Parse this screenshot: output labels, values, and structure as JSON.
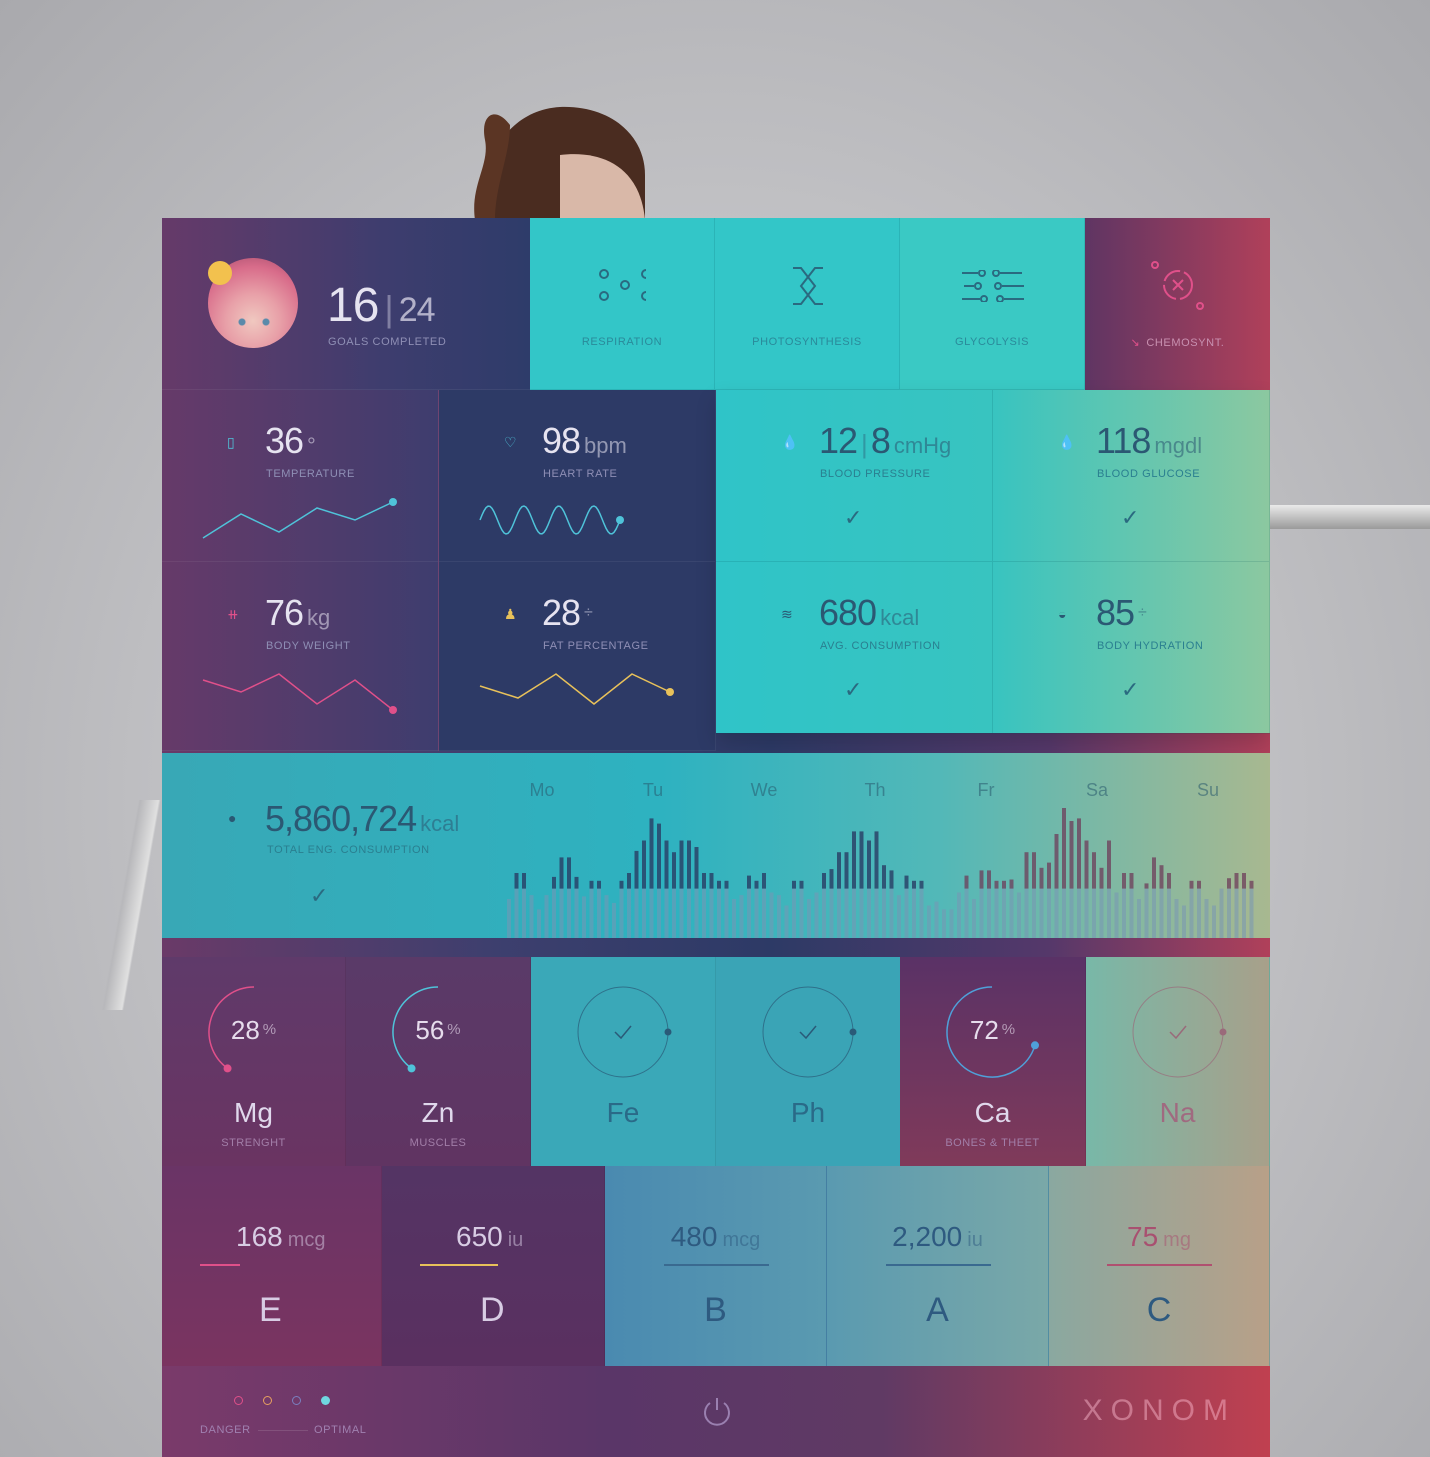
{
  "profile": {
    "goals_done": "16",
    "goals_total": "24",
    "goals_label": "GOALS COMPLETED",
    "status_color": "#f2c14e"
  },
  "processes": [
    {
      "label": "RESPIRATION",
      "icon": "respiration-dots-icon"
    },
    {
      "label": "PHOTOSYNTHESIS",
      "icon": "dna-cross-icon"
    },
    {
      "label": "GLYCOLYSIS",
      "icon": "sliders-icon"
    },
    {
      "label": "CHEMOSYNT.",
      "icon": "target-x-icon",
      "arrow": "↘"
    }
  ],
  "vitals": [
    {
      "value": "36",
      "unit": "°",
      "label": "TEMPERATURE",
      "icon": "thermometer-icon",
      "color": "#4fc3d9",
      "spark": [
        6,
        2,
        5,
        1,
        3,
        0
      ]
    },
    {
      "value": "98",
      "unit": "bpm",
      "label": "HEART RATE",
      "icon": "heart-icon",
      "color": "#4fc3d9",
      "spark": "wave"
    },
    {
      "value": "12",
      "value2": "8",
      "unit": "cmHg",
      "label": "BLOOD PRESSURE",
      "icon": "drop-icon"
    },
    {
      "value": "118",
      "unit": "mgdl",
      "label": "BLOOD GLUCOSE",
      "icon": "drop-icon"
    },
    {
      "value": "76",
      "unit": "kg",
      "label": "BODY WEIGHT",
      "icon": "dumbbell-icon",
      "color": "#e0508a",
      "spark": [
        1,
        3,
        0,
        5,
        1,
        6
      ]
    },
    {
      "value": "28",
      "unit": "%",
      "label": "FAT PERCENTAGE",
      "icon": "person-icon",
      "color": "#e8c15a",
      "spark": [
        2,
        4,
        0,
        5,
        0,
        3
      ]
    },
    {
      "value": "680",
      "unit": "kcal",
      "label": "AVG. CONSUMPTION",
      "icon": "layers-icon"
    },
    {
      "value": "85",
      "unit": "%",
      "label": "BODY HYDRATION",
      "icon": "smile-icon"
    }
  ],
  "total": {
    "value": "5,860,724",
    "unit": "kcal",
    "label": "TOTAL ENG. CONSUMPTION",
    "icon": "person-icon"
  },
  "chart_data": {
    "type": "bar",
    "categories": [
      "Mo",
      "Tu",
      "We",
      "Th",
      "Fr",
      "Sa",
      "Su"
    ],
    "values": [
      30,
      50,
      50,
      33,
      22,
      33,
      47,
      62,
      62,
      47,
      32,
      44,
      44,
      33,
      27,
      44,
      50,
      67,
      75,
      92,
      88,
      75,
      66,
      75,
      75,
      70,
      50,
      50,
      44,
      44,
      30,
      33,
      48,
      44,
      50,
      35,
      33,
      25,
      44,
      44,
      30,
      35,
      50,
      53,
      66,
      66,
      82,
      82,
      75,
      82,
      56,
      52,
      33,
      48,
      44,
      44,
      25,
      28,
      22,
      22,
      35,
      48,
      30,
      52,
      52,
      44,
      44,
      45,
      35,
      66,
      66,
      54,
      58,
      80,
      100,
      90,
      92,
      75,
      66,
      54,
      75,
      35,
      50,
      50,
      30,
      42,
      62,
      56,
      50,
      30,
      25,
      44,
      44,
      30,
      25,
      38,
      46,
      50,
      50,
      44
    ]
  },
  "minerals": [
    {
      "symbol": "Mg",
      "value": "28",
      "unit": "%",
      "sub": "STRENGHT",
      "type": "arc",
      "color": "#e0508a",
      "fraction": 0.4
    },
    {
      "symbol": "Zn",
      "value": "56",
      "unit": "%",
      "sub": "MUSCLES",
      "type": "arc",
      "color": "#4fc3d9",
      "fraction": 0.4
    },
    {
      "symbol": "Fe",
      "type": "check"
    },
    {
      "symbol": "Ph",
      "type": "check"
    },
    {
      "symbol": "Ca",
      "value": "72",
      "unit": "%",
      "sub": "BONES & THEET",
      "type": "arc",
      "color": "#4fa0d9",
      "fraction": 0.65
    },
    {
      "symbol": "Na",
      "type": "check"
    }
  ],
  "vitamins": [
    {
      "letter": "E",
      "value": "168",
      "unit": "mcg",
      "color": "#e0508a"
    },
    {
      "letter": "D",
      "value": "650",
      "unit": "iu",
      "color": "#e8c15a"
    },
    {
      "letter": "B",
      "value": "480",
      "unit": "mcg",
      "color": "#3a6a90"
    },
    {
      "letter": "A",
      "value": "2,200",
      "unit": "iu",
      "color": "#3a6a90"
    },
    {
      "letter": "C",
      "value": "75",
      "unit": "mg",
      "color": "#b05070"
    }
  ],
  "footer": {
    "danger": "DANGER",
    "optimal": "OPTIMAL",
    "legend_colors": [
      "#e0508a",
      "#e8a060",
      "#7a80c0",
      "#6fd6e0"
    ],
    "brand": "XONOM"
  }
}
